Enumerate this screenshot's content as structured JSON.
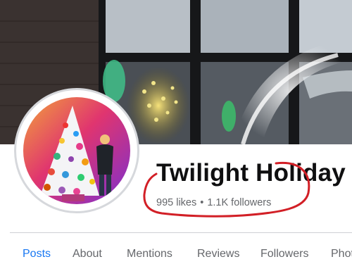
{
  "page": {
    "name": "Twilight Holiday",
    "likes": "995 likes",
    "separator": "•",
    "followers": "1.1K followers"
  },
  "tabs": [
    {
      "label": "Posts",
      "active": true
    },
    {
      "label": "About",
      "active": false
    },
    {
      "label": "Mentions",
      "active": false
    },
    {
      "label": "Reviews",
      "active": false
    },
    {
      "label": "Followers",
      "active": false
    },
    {
      "label": "Photos",
      "active": false
    }
  ],
  "colors": {
    "accent": "#1877f2",
    "annotation": "#d21f26",
    "muted_text": "#65676b"
  },
  "icons": {
    "cover": "cover-photo",
    "profile": "profile-photo-christmas-tree"
  }
}
